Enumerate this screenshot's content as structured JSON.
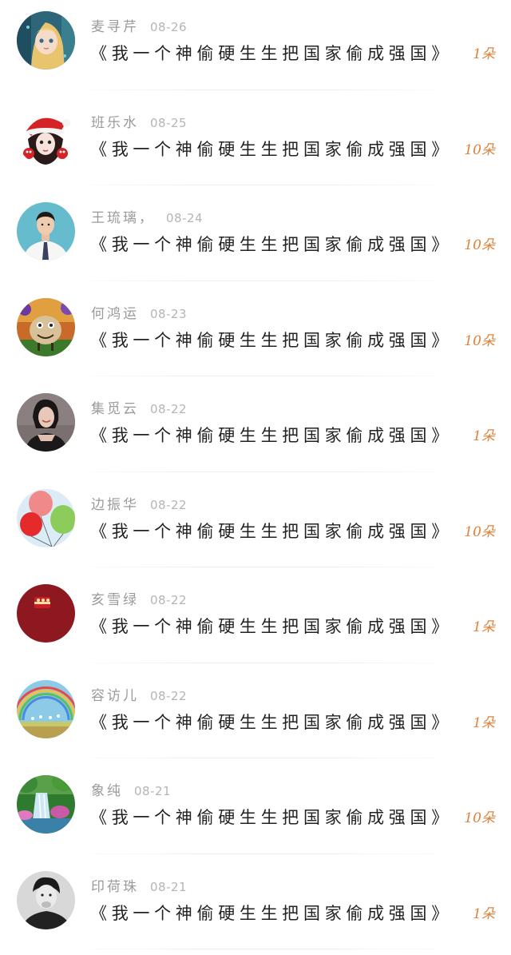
{
  "items": [
    {
      "name": "麦寻芹",
      "date": "08-26",
      "title": "《我一个神偷硬生生把国家偷成强国》",
      "gift": "1朵",
      "avatar_icon": "anime-girl-avatar",
      "avatar_color": "#2a6a7a"
    },
    {
      "name": "班乐水",
      "date": "08-25",
      "title": "《我一个神偷硬生生把国家偷成强国》",
      "gift": "10朵",
      "avatar_icon": "christmas-hat-girl-avatar",
      "avatar_color": "#d42a2a"
    },
    {
      "name": "王琉璃，",
      "date": "08-24",
      "title": "《我一个神偷硬生生把国家偷成强国》",
      "gift": "10朵",
      "avatar_icon": "man-in-suit-avatar",
      "avatar_color": "#5fb8c8"
    },
    {
      "name": "何鸿运",
      "date": "08-23",
      "title": "《我一个神偷硬生生把国家偷成强国》",
      "gift": "10朵",
      "avatar_icon": "cartoon-creature-avatar",
      "avatar_color": "#d8a040"
    },
    {
      "name": "集觅云",
      "date": "08-22",
      "title": "《我一个神偷硬生生把国家偷成强国》",
      "gift": "1朵",
      "avatar_icon": "woman-portrait-avatar",
      "avatar_color": "#6a6262"
    },
    {
      "name": "边振华",
      "date": "08-22",
      "title": "《我一个神偷硬生生把国家偷成强国》",
      "gift": "10朵",
      "avatar_icon": "balloons-avatar",
      "avatar_color": "#cfe4f4"
    },
    {
      "name": "亥雪绿",
      "date": "08-22",
      "title": "《我一个神偷硬生生把国家偷成强国》",
      "gift": "1朵",
      "avatar_icon": "red-bag-avatar",
      "avatar_color": "#8e1820"
    },
    {
      "name": "容访儿",
      "date": "08-22",
      "title": "《我一个神偷硬生生把国家偷成强国》",
      "gift": "1朵",
      "avatar_icon": "rainbow-field-avatar",
      "avatar_color": "#8cc8e8"
    },
    {
      "name": "象纯",
      "date": "08-21",
      "title": "《我一个神偷硬生生把国家偷成强国》",
      "gift": "10朵",
      "avatar_icon": "waterfall-avatar",
      "avatar_color": "#3a8a3a"
    },
    {
      "name": "印荷珠",
      "date": "08-21",
      "title": "《我一个神偷硬生生把国家偷成强国》",
      "gift": "1朵",
      "avatar_icon": "man-bw-portrait-avatar",
      "avatar_color": "#9a9a9a"
    }
  ]
}
